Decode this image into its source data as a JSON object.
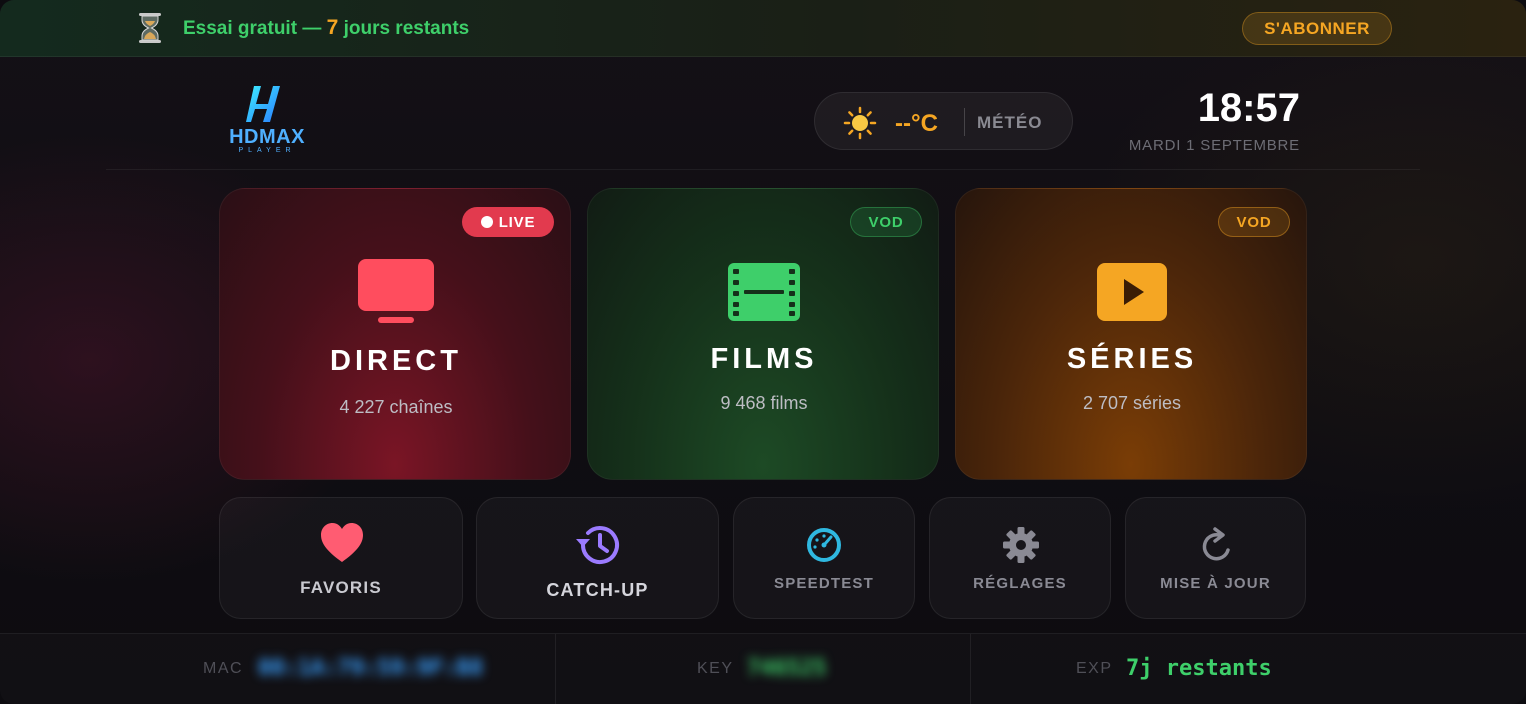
{
  "trial": {
    "prefix": "Essai gratuit —",
    "days": "7",
    "suffix": "jours restants",
    "subscribe_label": "S'ABONNER"
  },
  "header": {
    "logo_text": "HDMAX",
    "logo_subtext": "PLAYER",
    "weather_temp": "--°C",
    "weather_label": "MÉTÉO",
    "weather_icon": "sun-icon",
    "time": "18:57",
    "date": "MARDI 1 SEPTEMBRE"
  },
  "cards": {
    "direct": {
      "badge": "LIVE",
      "title": "DIRECT",
      "subtitle": "4 227 chaînes",
      "icon": "tv-icon",
      "color": "#ff4d5e"
    },
    "films": {
      "badge": "VOD",
      "title": "FILMS",
      "subtitle": "9 468 films",
      "icon": "film-icon",
      "color": "#3ecf6a"
    },
    "series": {
      "badge": "VOD",
      "title": "SÉRIES",
      "subtitle": "2 707 séries",
      "icon": "play-icon",
      "color": "#f5a623"
    }
  },
  "tiles": {
    "favoris": {
      "label": "FAVORIS",
      "icon": "heart-icon",
      "color": "#ff5c72"
    },
    "catchup": {
      "label": "CATCH-UP",
      "icon": "history-icon",
      "color": "#9b7bff"
    },
    "speedtest": {
      "label": "SPEEDTEST",
      "icon": "speedometer-icon",
      "color": "#2fb8e0"
    },
    "reglages": {
      "label": "RÉGLAGES",
      "icon": "gear-icon",
      "color": "#8a8a94"
    },
    "maj": {
      "label": "MISE À JOUR",
      "icon": "refresh-icon",
      "color": "#8a8a94"
    }
  },
  "footer": {
    "mac_label": "MAC",
    "mac_value": "00:1A:79:59:9F:B8",
    "key_label": "KEY",
    "key_value": "746525",
    "exp_label": "EXP",
    "exp_value": "7j restants"
  },
  "colors": {
    "accent_green": "#3ecf6a",
    "accent_orange": "#f5a623",
    "accent_red": "#e23a4e",
    "mac_blue": "#3aa0ff"
  }
}
